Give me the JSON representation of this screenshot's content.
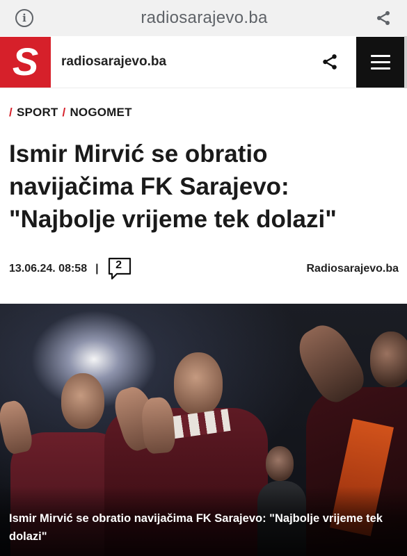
{
  "browser": {
    "url": "radiosarajevo.ba",
    "info_icon": "info-icon",
    "share_icon": "share-icon"
  },
  "header": {
    "logo_letter": "S",
    "site_name": "radiosarajevo.ba",
    "share_icon": "share-icon",
    "menu_icon": "hamburger-menu-icon",
    "brand_color": "#d6202a"
  },
  "breadcrumb": {
    "items": [
      "SPORT",
      "NOGOMET"
    ],
    "separator": "/"
  },
  "article": {
    "title_lines": [
      "Ismir Mirvić se obratio",
      "navijačima FK Sarajevo:",
      "\"Najbolje vrijeme tek dolazi\""
    ],
    "date": "13.06.24. 08:58",
    "meta_separator": "|",
    "comment_count": "2",
    "source": "Radiosarajevo.ba"
  },
  "hero": {
    "caption": "Ismir Mirvić se obratio navijačima FK Sarajevo: \"Najbolje vrijeme tek dolazi\""
  }
}
